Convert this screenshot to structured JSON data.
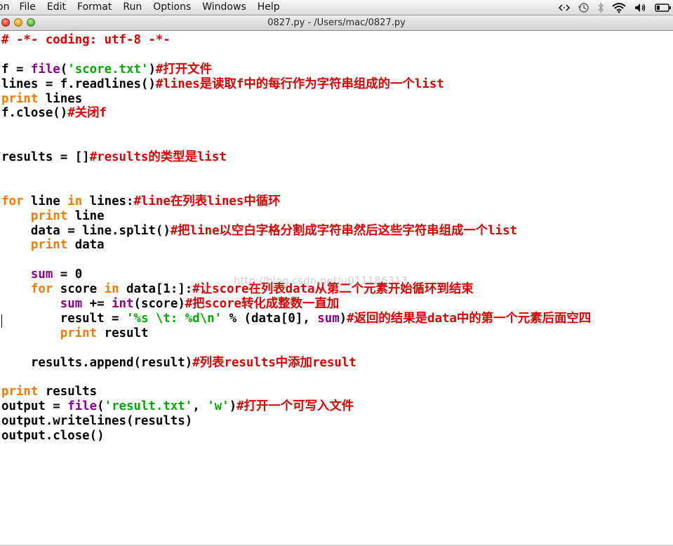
{
  "menubar": {
    "app_menu": "on",
    "items": [
      "File",
      "Edit",
      "Format",
      "Run",
      "Options",
      "Windows",
      "Help"
    ],
    "status_icons": [
      "code-arrows-icon",
      "time-machine-icon",
      "bluetooth-icon",
      "wifi-icon",
      "volume-icon",
      "battery-icon"
    ]
  },
  "window": {
    "title": "0827.py - /Users/mac/0827.py"
  },
  "watermark": "http://blog.csdn.net/u011186313",
  "colors": {
    "keyword": "#ff7700",
    "builtin": "#900090",
    "string": "#00aa00",
    "comment": "#dd0000",
    "text": "#000000"
  },
  "code_lines": [
    [
      {
        "t": "# -*- coding: utf-8 -*-",
        "c": "com"
      }
    ],
    [],
    [
      {
        "t": "f = "
      },
      {
        "t": "file",
        "c": "bi"
      },
      {
        "t": "("
      },
      {
        "t": "'score.txt'",
        "c": "str"
      },
      {
        "t": ")"
      },
      {
        "t": "#打开文件",
        "c": "com"
      }
    ],
    [
      {
        "t": "lines = f.readlines()"
      },
      {
        "t": "#lines是读取f中的每行作为字符串组成的一个list",
        "c": "com"
      }
    ],
    [
      {
        "t": "print",
        "c": "kw"
      },
      {
        "t": " lines"
      }
    ],
    [
      {
        "t": "f.close()"
      },
      {
        "t": "#关闭f",
        "c": "com"
      }
    ],
    [],
    [],
    [
      {
        "t": "results = []"
      },
      {
        "t": "#results的类型是list",
        "c": "com"
      }
    ],
    [],
    [],
    [
      {
        "t": "for",
        "c": "kw"
      },
      {
        "t": " line "
      },
      {
        "t": "in",
        "c": "kw"
      },
      {
        "t": " lines:"
      },
      {
        "t": "#line在列表lines中循环",
        "c": "com"
      }
    ],
    [
      {
        "t": "    "
      },
      {
        "t": "print",
        "c": "kw"
      },
      {
        "t": " line"
      }
    ],
    [
      {
        "t": "    data = line.split()"
      },
      {
        "t": "#把line以空白字格分割成字符串然后这些字符串组成一个list",
        "c": "com"
      }
    ],
    [
      {
        "t": "    "
      },
      {
        "t": "print",
        "c": "kw"
      },
      {
        "t": " data"
      }
    ],
    [],
    [
      {
        "t": "    "
      },
      {
        "t": "sum",
        "c": "bi"
      },
      {
        "t": " = 0"
      }
    ],
    [
      {
        "t": "    "
      },
      {
        "t": "for",
        "c": "kw"
      },
      {
        "t": " score "
      },
      {
        "t": "in",
        "c": "kw"
      },
      {
        "t": " data[1:]:"
      },
      {
        "t": "#让score在列表data从第二个元素开始循环到结束",
        "c": "com"
      }
    ],
    [
      {
        "t": "        "
      },
      {
        "t": "sum",
        "c": "bi"
      },
      {
        "t": " += "
      },
      {
        "t": "int",
        "c": "bi"
      },
      {
        "t": "(score)"
      },
      {
        "t": "#把score转化成整数一直加",
        "c": "com"
      }
    ],
    [
      {
        "t": "        result = "
      },
      {
        "t": "'%s \\t: %d\\n'",
        "c": "str"
      },
      {
        "t": " % (data[0], "
      },
      {
        "t": "sum",
        "c": "bi"
      },
      {
        "t": ")"
      },
      {
        "t": "#返回的结果是data中的第一个元素后面空四",
        "c": "com"
      }
    ],
    [
      {
        "t": "        "
      },
      {
        "t": "print",
        "c": "kw"
      },
      {
        "t": " result"
      }
    ],
    [],
    [
      {
        "t": "    results.append(result)"
      },
      {
        "t": "#列表results中添加result",
        "c": "com"
      }
    ],
    [],
    [
      {
        "t": "print",
        "c": "kw"
      },
      {
        "t": " results"
      }
    ],
    [
      {
        "t": "output = "
      },
      {
        "t": "file",
        "c": "bi"
      },
      {
        "t": "("
      },
      {
        "t": "'result.txt'",
        "c": "str"
      },
      {
        "t": ", "
      },
      {
        "t": "'w'",
        "c": "str"
      },
      {
        "t": ")"
      },
      {
        "t": "#打开一个可写入文件",
        "c": "com"
      }
    ],
    [
      {
        "t": "output.writelines(results)"
      }
    ],
    [
      {
        "t": "output.close()"
      }
    ]
  ]
}
